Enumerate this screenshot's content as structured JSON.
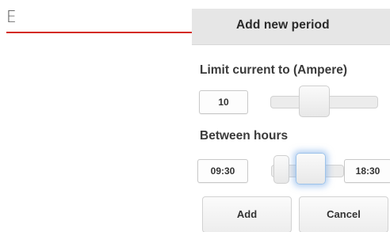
{
  "annotation": {
    "label": "E",
    "arrow_color": "#d42a1c"
  },
  "dialog": {
    "title": "Add new period"
  },
  "current_limit": {
    "label": "Limit current to (Ampere)",
    "value": "10"
  },
  "hours": {
    "label": "Between hours",
    "from": "09:30",
    "to": "18:30"
  },
  "buttons": {
    "add": "Add",
    "cancel": "Cancel"
  }
}
